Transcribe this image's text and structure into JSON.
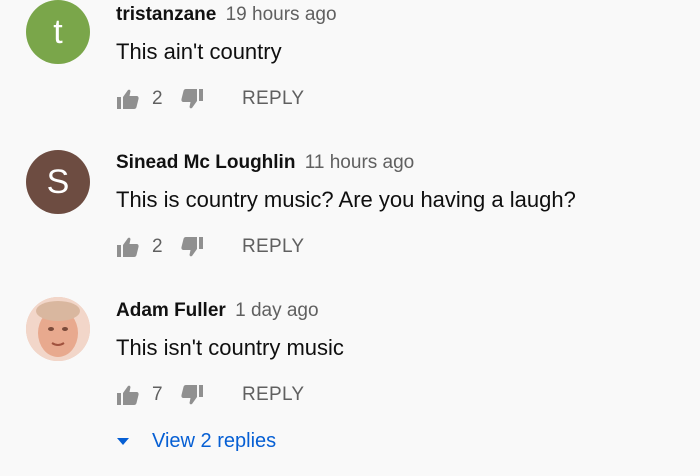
{
  "comments": [
    {
      "author": "tristanzane",
      "time": "19 hours ago",
      "text": "This ain't country",
      "likes": "2",
      "avatar_letter": "t",
      "avatar_color": "#7aa64a",
      "reply_label": "REPLY"
    },
    {
      "author": "Sinead Mc Loughlin",
      "time": "11 hours ago",
      "text": "This is country music? Are you having a laugh?",
      "likes": "2",
      "avatar_letter": "S",
      "avatar_color": "#6d4c41",
      "reply_label": "REPLY"
    },
    {
      "author": "Adam Fuller",
      "time": "1 day ago",
      "text": "This isn't country music",
      "likes": "7",
      "avatar_letter": "",
      "avatar_color": "#e9c2b0",
      "reply_label": "REPLY"
    }
  ],
  "view_replies_label": "View 2 replies",
  "icons": {
    "like": "thumbs-up-icon",
    "dislike": "thumbs-down-icon",
    "expand": "caret-down-icon"
  },
  "colors": {
    "link": "#065fd4",
    "secondary_text": "#606060",
    "icon": "#909090"
  }
}
